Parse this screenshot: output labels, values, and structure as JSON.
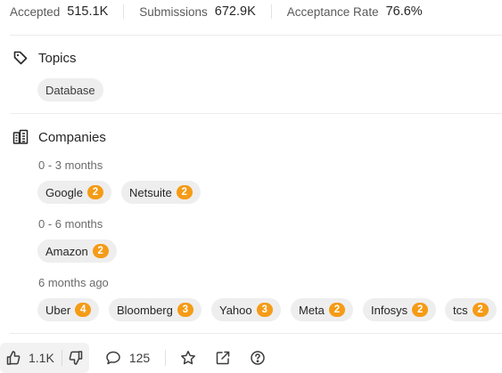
{
  "stats": [
    {
      "label": "Accepted",
      "value": "515.1K"
    },
    {
      "label": "Submissions",
      "value": "672.9K"
    },
    {
      "label": "Acceptance Rate",
      "value": "76.6%"
    }
  ],
  "topics": {
    "title": "Topics",
    "icon": "tag-icon",
    "tags": [
      "Database"
    ]
  },
  "companies": {
    "title": "Companies",
    "icon": "building-icon",
    "groups": [
      {
        "period": "0 - 3 months",
        "items": [
          {
            "name": "Google",
            "count": "2"
          },
          {
            "name": "Netsuite",
            "count": "2"
          }
        ]
      },
      {
        "period": "0 - 6 months",
        "items": [
          {
            "name": "Amazon",
            "count": "2"
          }
        ]
      },
      {
        "period": "6 months ago",
        "items": [
          {
            "name": "Uber",
            "count": "4"
          },
          {
            "name": "Bloomberg",
            "count": "3"
          },
          {
            "name": "Yahoo",
            "count": "3"
          },
          {
            "name": "Meta",
            "count": "2"
          },
          {
            "name": "Infosys",
            "count": "2"
          },
          {
            "name": "tcs",
            "count": "2"
          }
        ]
      }
    ]
  },
  "footer": {
    "likes": "1.1K",
    "comments": "125",
    "icons": [
      "thumbs-up-icon",
      "thumbs-down-icon",
      "comment-icon",
      "star-icon",
      "share-icon",
      "help-icon"
    ]
  },
  "colors": {
    "badge": "#f59b16",
    "chip": "#eeeeee",
    "text": "#262626"
  }
}
